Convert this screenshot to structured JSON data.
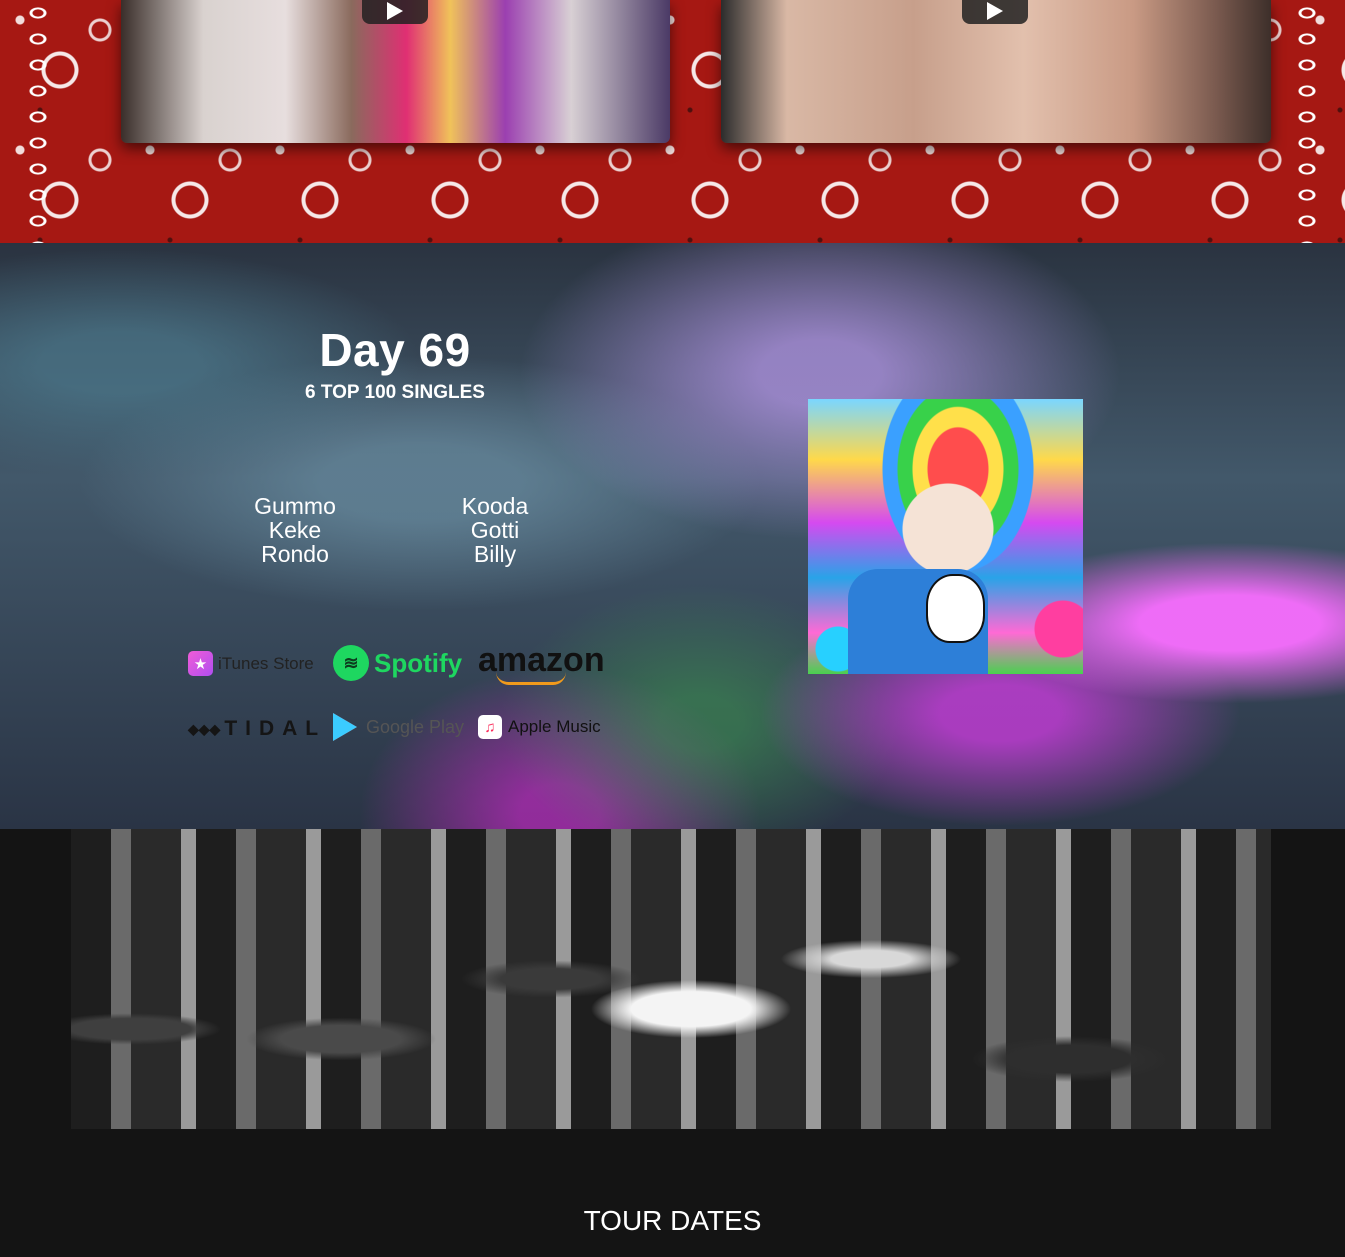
{
  "videos": [
    {
      "name": "video-1",
      "play_icon": "play-icon"
    },
    {
      "name": "video-2",
      "play_icon": "play-icon"
    }
  ],
  "album": {
    "title": "Day 69",
    "subtitle": "6 TOP 100 SINGLES",
    "singles_left": [
      "Gummo",
      "Keke",
      "Rondo"
    ],
    "singles_right": [
      "Kooda",
      "Gotti",
      "Billy"
    ],
    "stores": {
      "itunes": "iTunes Store",
      "spotify": "Spotify",
      "amazon": "amazon",
      "tidal": "TIDAL",
      "google_play": "Google Play",
      "apple_music": "Apple Music"
    }
  },
  "tour": {
    "title": "TOUR DATES"
  },
  "colors": {
    "bandana_red": "#a61813",
    "page_bg": "#141414",
    "spotify_green": "#1ed760",
    "amazon_orange": "#f19a1c"
  }
}
